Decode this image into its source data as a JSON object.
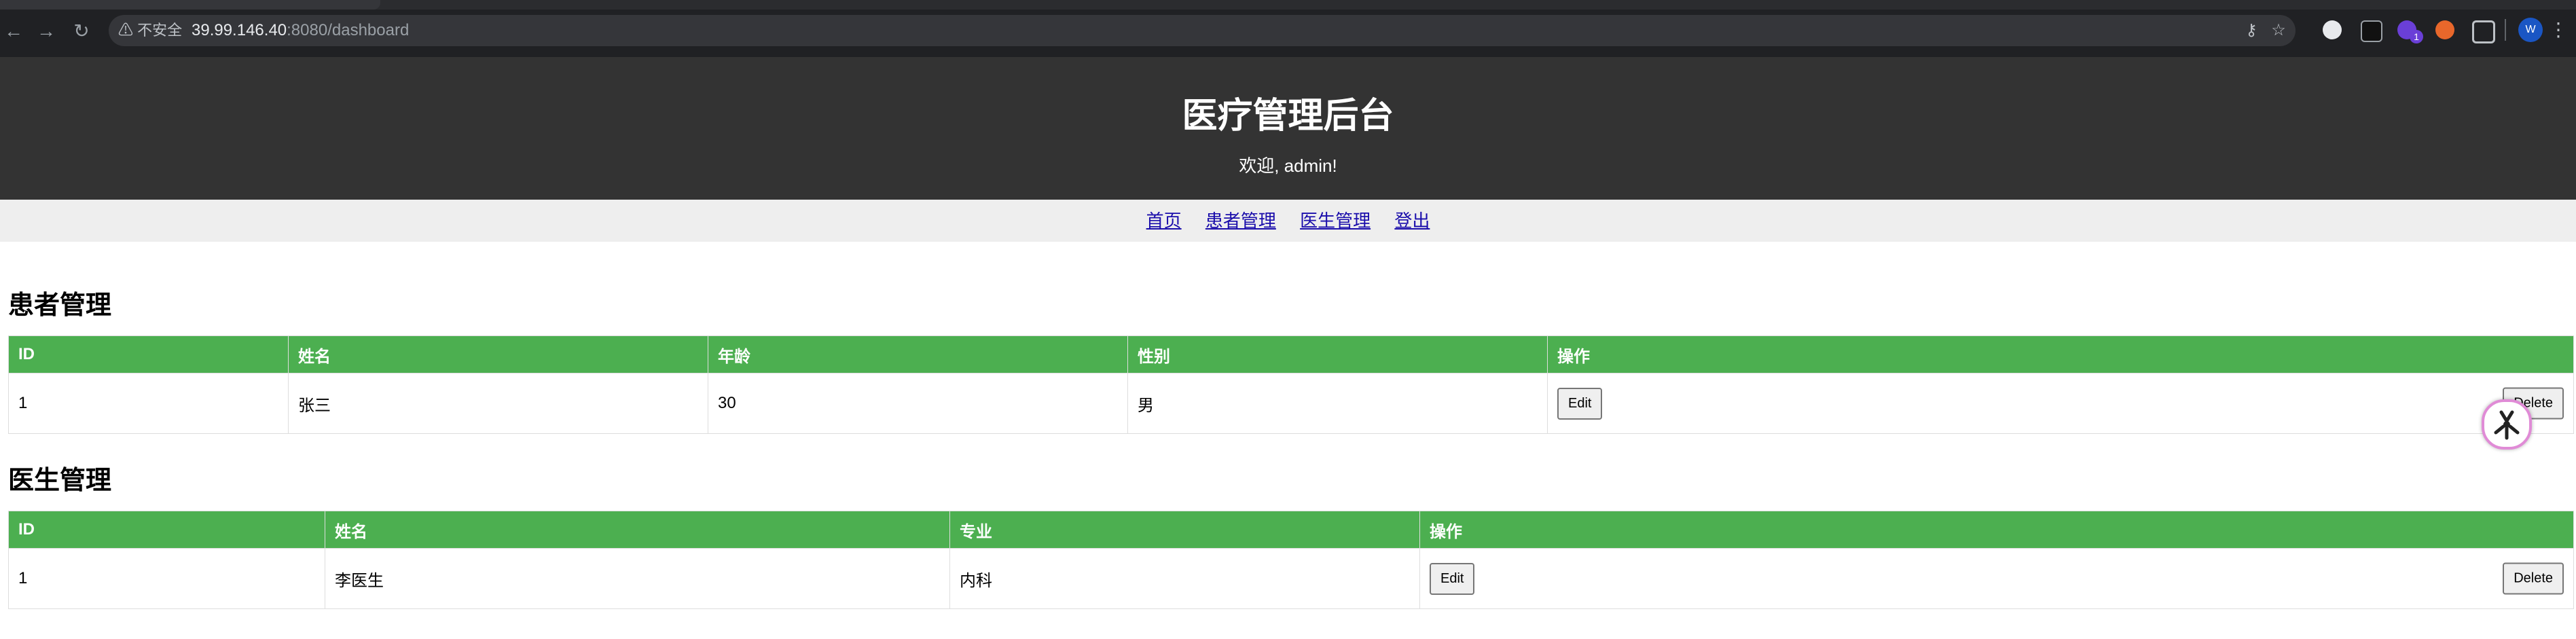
{
  "browser": {
    "security_label": "⚠ 不安全",
    "url_host": "39.99.146.40",
    "url_rest": ":8080/dashboard",
    "extension_badge": "1",
    "profile_initial": "W",
    "icons": [
      "back-icon",
      "forward-icon",
      "reload-icon",
      "key-icon",
      "star-icon",
      "extension-icon"
    ]
  },
  "header": {
    "title": "医疗管理后台",
    "welcome": "欢迎, admin!"
  },
  "nav": {
    "home": "首页",
    "patients": "患者管理",
    "doctors": "医生管理",
    "logout": "登出"
  },
  "patients": {
    "title": "患者管理",
    "columns": [
      "ID",
      "姓名",
      "年龄",
      "性别",
      "操作"
    ],
    "rows": [
      {
        "id": "1",
        "name": "张三",
        "age": "30",
        "gender": "男",
        "edit": "Edit",
        "delete": "Delete"
      }
    ]
  },
  "doctors": {
    "title": "医生管理",
    "columns": [
      "ID",
      "姓名",
      "专业",
      "操作"
    ],
    "rows": [
      {
        "id": "1",
        "name": "李医生",
        "specialty": "内科",
        "edit": "Edit",
        "delete": "Delete"
      }
    ]
  },
  "colors": {
    "header_bg": "#333333",
    "table_header": "#4caf50",
    "nav_bg": "#eeeeee"
  }
}
